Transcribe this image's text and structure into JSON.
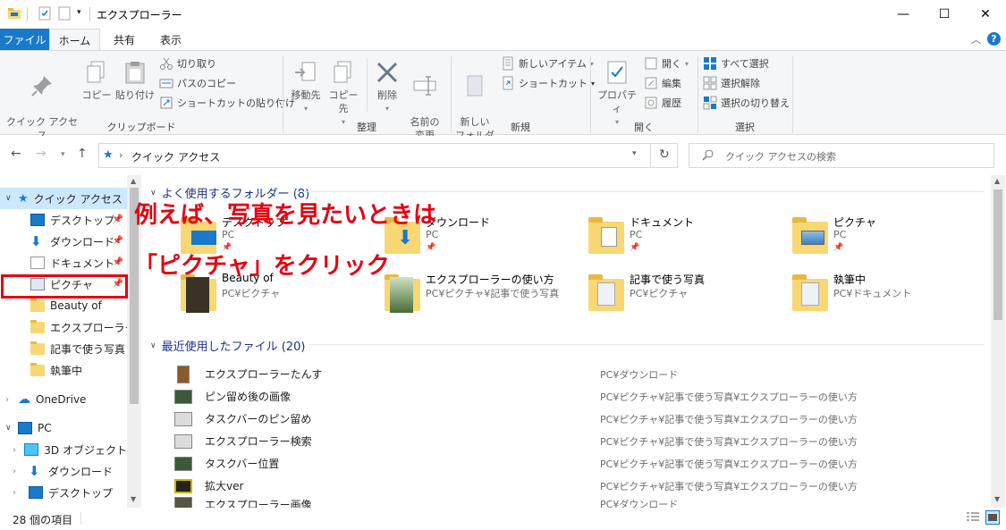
{
  "window": {
    "title": "エクスプローラー",
    "minimize": "—",
    "maximize": "☐",
    "close": "✕"
  },
  "ribbon_tabs": [
    "ファイル",
    "ホーム",
    "共有",
    "表示"
  ],
  "ribbon": {
    "clipboard": {
      "label": "クリップボード",
      "pin": "クイック アクセス\nにピン留めする",
      "copy": "コピー",
      "paste": "貼り付け",
      "cut": "切り取り",
      "copy_path": "パスのコピー",
      "paste_shortcut": "ショートカットの貼り付け"
    },
    "organize": {
      "label": "整理",
      "move_to": "移動先",
      "copy_to": "コピー先",
      "delete": "削除",
      "rename": "名前の\n変更"
    },
    "new": {
      "label": "新規",
      "new_folder": "新しい\nフォルダー",
      "new_item": "新しいアイテム",
      "shortcut": "ショートカット"
    },
    "open": {
      "label": "開く",
      "properties": "プロパティ",
      "open": "開く",
      "edit": "編集",
      "history": "履歴"
    },
    "select": {
      "label": "選択",
      "select_all": "すべて選択",
      "select_none": "選択解除",
      "invert": "選択の切り替え"
    }
  },
  "address": {
    "path_root": "クイック アクセス",
    "search_placeholder": "クイック アクセスの検索"
  },
  "navpane": {
    "quick_access": "クイック アクセス",
    "items": [
      "デスクトップ",
      "ダウンロード",
      "ドキュメント",
      "ピクチャ",
      "Beauty of",
      "エクスプローラーの使",
      "記事で使う写真",
      "執筆中"
    ],
    "onedrive": "OneDrive",
    "pc": "PC",
    "pc_items": [
      "3D オブジェクト",
      "ダウンロード",
      "デスクトップ"
    ]
  },
  "content": {
    "frequent_header": "よく使用するフォルダー (8)",
    "frequent": [
      {
        "name": "デスクトップ",
        "sub": "PC"
      },
      {
        "name": "ダウンロード",
        "sub": "PC"
      },
      {
        "name": "ドキュメント",
        "sub": "PC"
      },
      {
        "name": "ピクチャ",
        "sub": "PC"
      },
      {
        "name": "Beauty of",
        "sub": "PC¥ピクチャ"
      },
      {
        "name": "エクスプローラーの使い方",
        "sub": "PC¥ピクチャ¥記事で使う写真"
      },
      {
        "name": "記事で使う写真",
        "sub": "PC¥ピクチャ"
      },
      {
        "name": "執筆中",
        "sub": "PC¥ドキュメント"
      }
    ],
    "recent_header": "最近使用したファイル (20)",
    "recent": [
      {
        "name": "エクスプローラーたんす",
        "path": "PC¥ダウンロード"
      },
      {
        "name": "ピン留め後の画像",
        "path": "PC¥ピクチャ¥記事で使う写真¥エクスプローラーの使い方"
      },
      {
        "name": "タスクバーのピン留め",
        "path": "PC¥ピクチャ¥記事で使う写真¥エクスプローラーの使い方"
      },
      {
        "name": "エクスプローラー検索",
        "path": "PC¥ピクチャ¥記事で使う写真¥エクスプローラーの使い方"
      },
      {
        "name": "タスクバー位置",
        "path": "PC¥ピクチャ¥記事で使う写真¥エクスプローラーの使い方"
      },
      {
        "name": "拡大ver",
        "path": "PC¥ピクチャ¥記事で使う写真¥エクスプローラーの使い方"
      },
      {
        "name": "エクスプローラー画像",
        "path": "PC¥ダウンロード"
      }
    ]
  },
  "annotations": {
    "line1": "例えば、写真を見たいときは",
    "line2": "「ピクチャ」をクリック"
  },
  "status": {
    "item_count": "28 個の項目"
  },
  "colors": {
    "accent": "#1979ca",
    "highlight": "#e60012",
    "folder": "#f8d775"
  }
}
